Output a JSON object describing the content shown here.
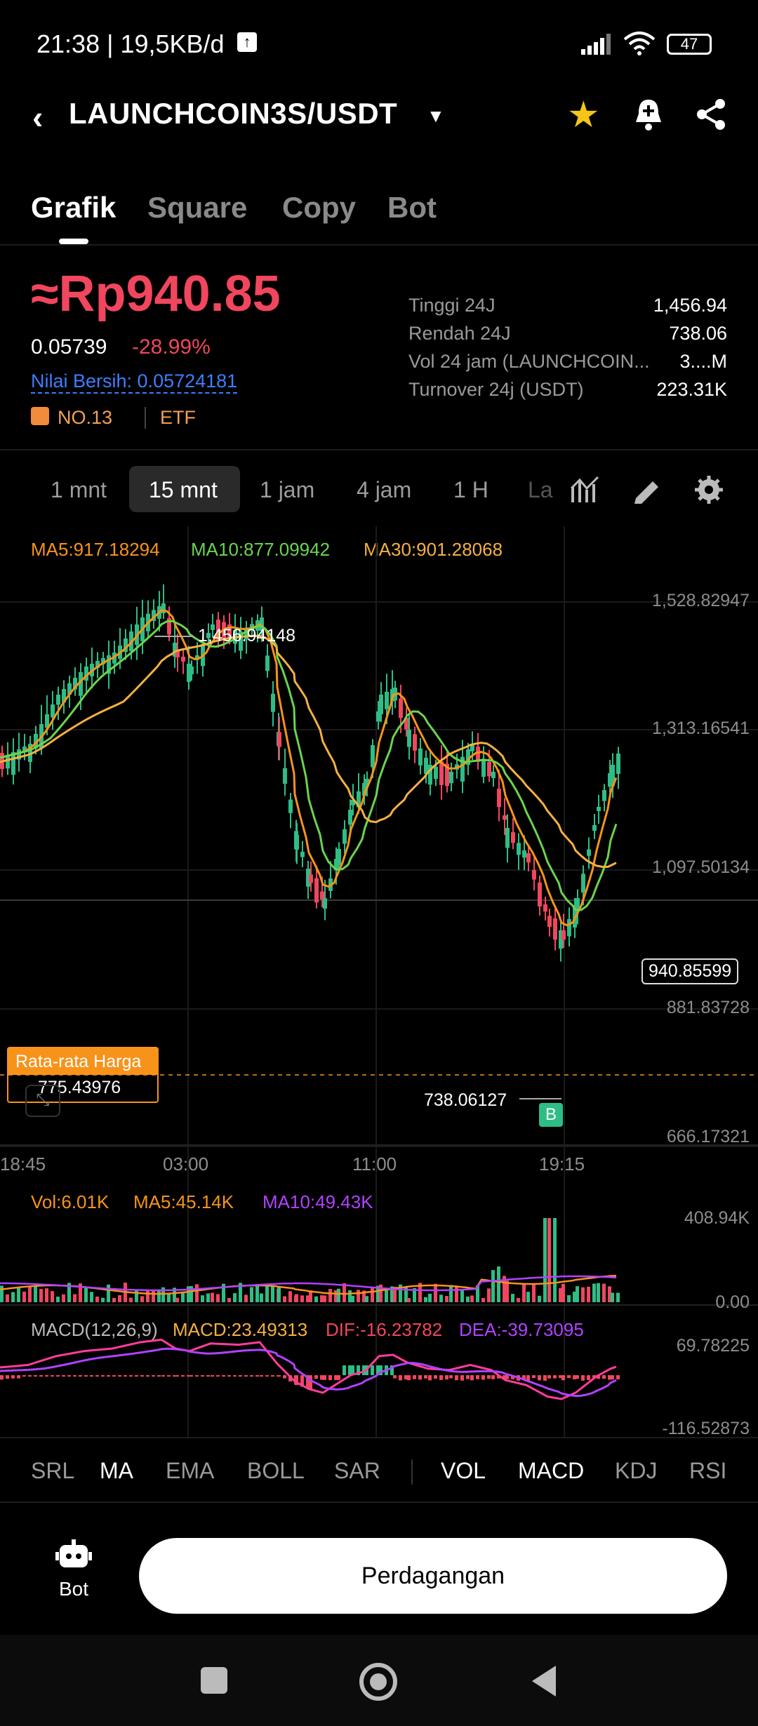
{
  "status_bar": {
    "time": "21:38 | 19,5KB/d",
    "battery": "47"
  },
  "header": {
    "pair": "LAUNCHCOIN3S/USDT"
  },
  "tabs": [
    "Grafik",
    "Square",
    "Copy",
    "Bot"
  ],
  "price": {
    "main": "≈Rp940.85",
    "last": "0.05739",
    "change": "-28.99%",
    "net_value": "Nilai Bersih: 0.05724181",
    "rank": "NO.13",
    "etf": "ETF"
  },
  "stats": [
    {
      "label": "Tinggi 24J",
      "value": "1,456.94"
    },
    {
      "label": "Rendah 24J",
      "value": "738.06"
    },
    {
      "label": "Vol 24 jam (LAUNCHCOIN...",
      "value": "3....M"
    },
    {
      "label": "Turnover 24j (USDT)",
      "value": "223.31K"
    }
  ],
  "intervals": [
    "1 mnt",
    "15 mnt",
    "1 jam",
    "4 jam",
    "1 H",
    "La"
  ],
  "ma_legend": {
    "ma5": "MA5:917.18294",
    "ma10": "MA10:877.09942",
    "ma30": "MA30:901.28068"
  },
  "price_axis": [
    "1,528.82947",
    "1,313.16541",
    "1,097.50134",
    "881.83728",
    "666.17321"
  ],
  "current_price_tag": "940.85599",
  "high_label": "1,456.94148",
  "low_label": "738.06127",
  "buy_marker": "B",
  "avg_price": {
    "label": "Rata-rata Harga",
    "value": "775.43976"
  },
  "time_axis": [
    "18:45",
    "03:00",
    "11:00",
    "19:15"
  ],
  "volume": {
    "vol": "Vol:6.01K",
    "ma5": "MA5:45.14K",
    "ma10": "MA10:49.43K",
    "max": "408.94K",
    "min": "0.00"
  },
  "macd": {
    "name": "MACD(12,26,9)",
    "macd": "MACD:23.49313",
    "dif": "DIF:-16.23782",
    "dea": "DEA:-39.73095",
    "max": "69.78225",
    "min": "-116.52873"
  },
  "indicator_tabs": [
    "SRL",
    "MA",
    "EMA",
    "BOLL",
    "SAR",
    "VOL",
    "MACD",
    "KDJ",
    "RSI"
  ],
  "bottom": {
    "bot_label": "Bot",
    "trade_label": "Perdagangan"
  },
  "colors": {
    "up": "#2ebd85",
    "down": "#f0465e",
    "ma5": "#f7931a",
    "ma10": "#6ad44f",
    "ma30": "#f5b041",
    "purple": "#b042ff"
  }
}
